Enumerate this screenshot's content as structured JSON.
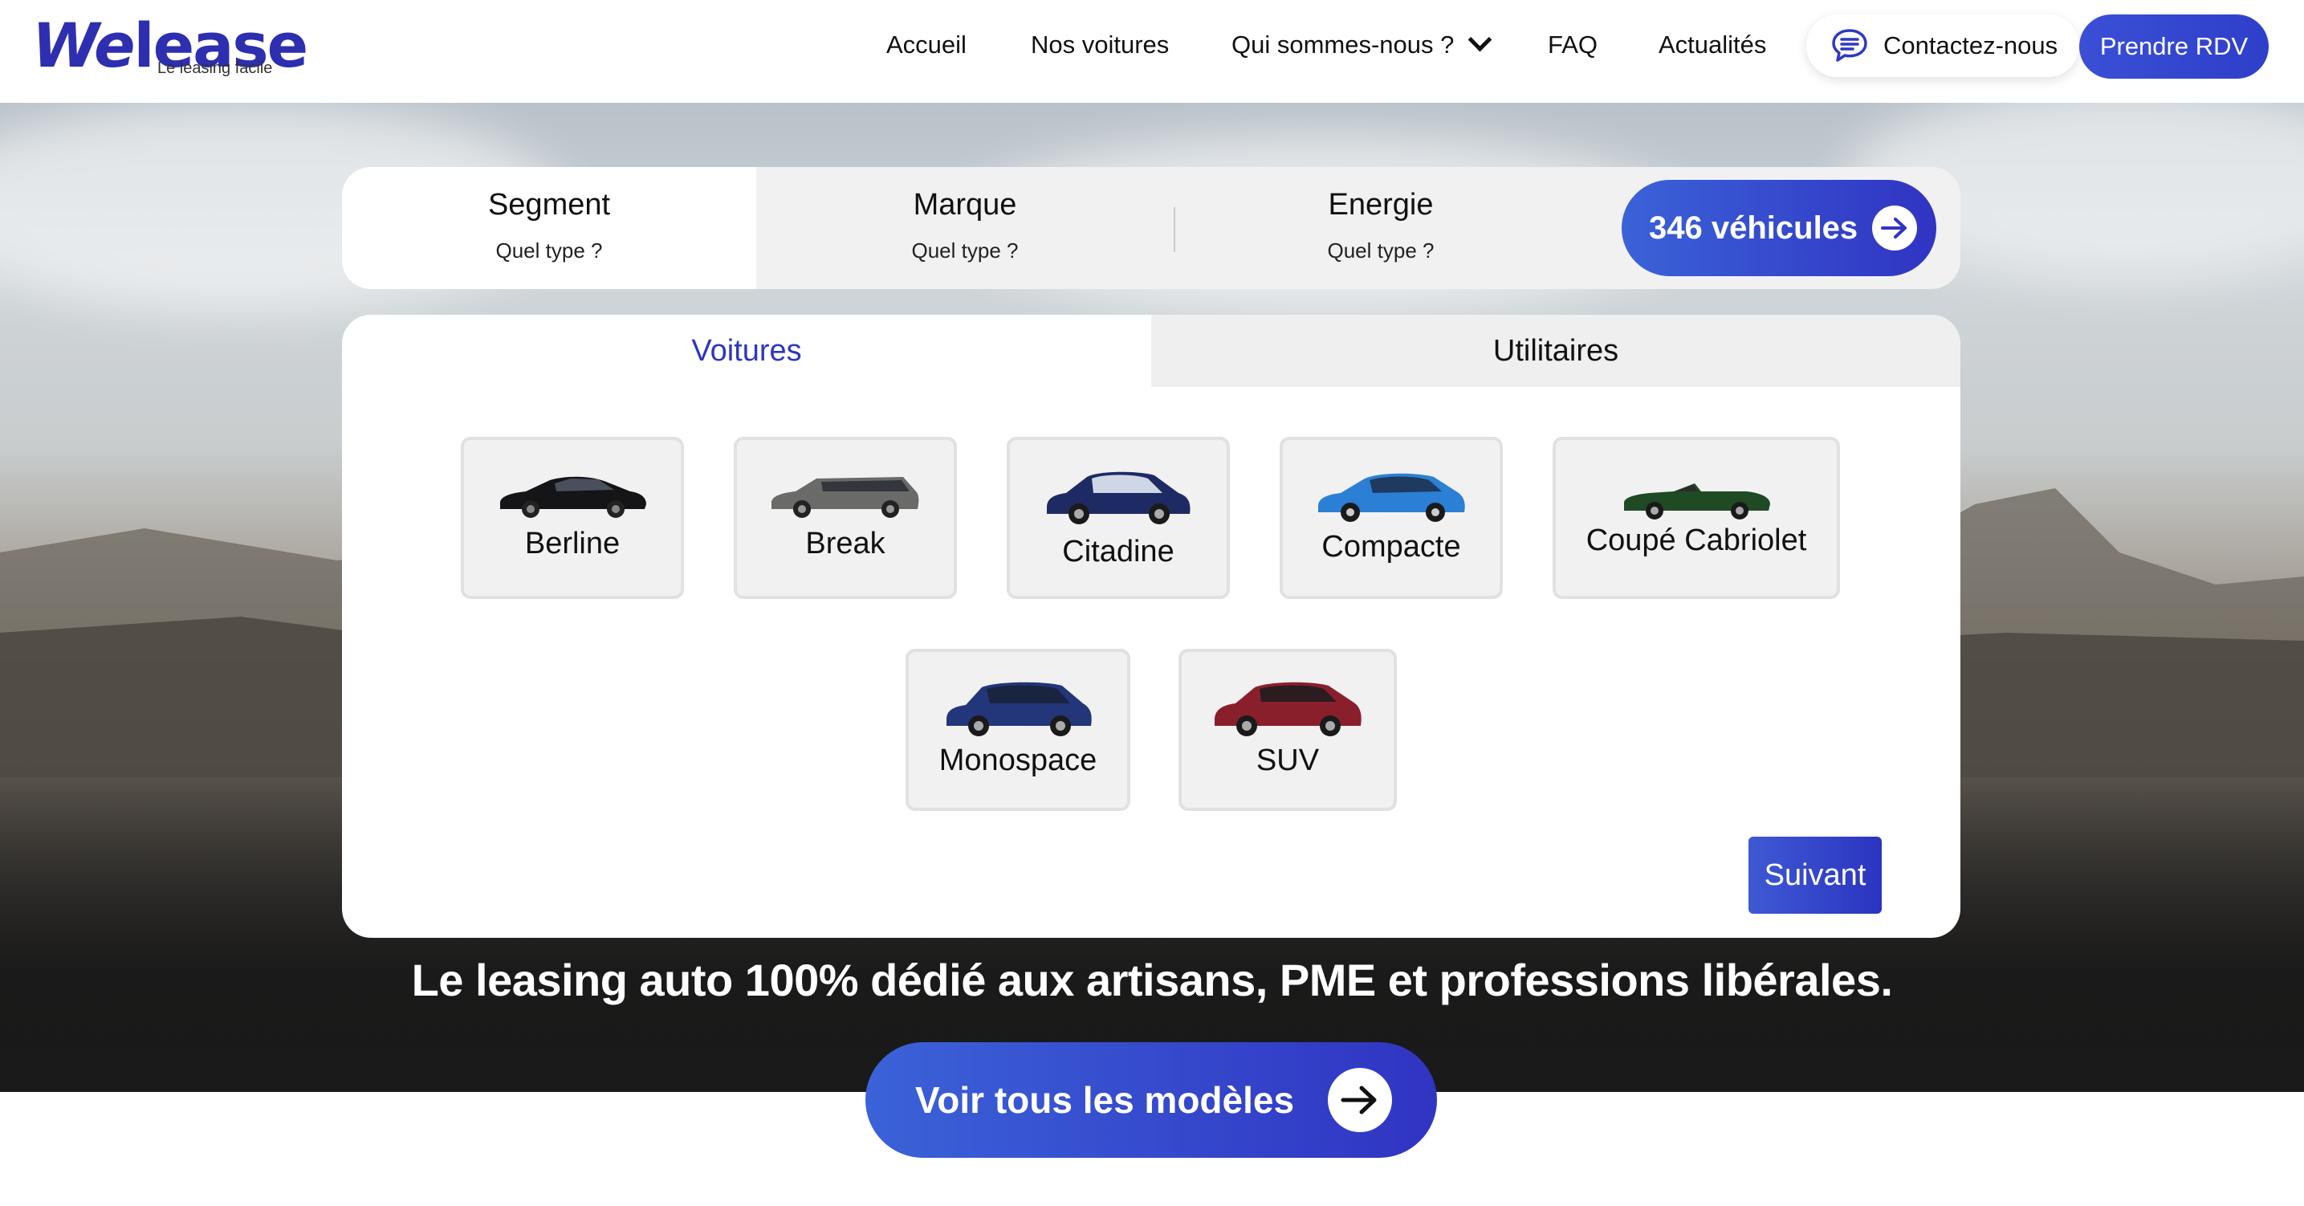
{
  "brand": {
    "logo_prefix": "We",
    "logo_suffix": "lease",
    "tagline": "Le leasing facile"
  },
  "nav": {
    "items": [
      "Accueil",
      "Nos voitures",
      "Qui sommes-nous ?",
      "FAQ",
      "Actualités"
    ],
    "contact_label": "Contactez-nous",
    "rdv_label": "Prendre RDV"
  },
  "filters": [
    {
      "title": "Segment",
      "subtitle": "Quel type ?",
      "active": true
    },
    {
      "title": "Marque",
      "subtitle": "Quel type ?",
      "active": false
    },
    {
      "title": "Energie",
      "subtitle": "Quel type ?",
      "active": false
    }
  ],
  "vehicle_count_label": "346 véhicules",
  "tabs": {
    "voitures": "Voitures",
    "utilitaires": "Utilitaires",
    "active": "voitures"
  },
  "segments": [
    {
      "label": "Berline",
      "color": "#151518"
    },
    {
      "label": "Break",
      "color": "#6a6a68"
    },
    {
      "label": "Citadine",
      "color": "#1d2a63"
    },
    {
      "label": "Compacte",
      "color": "#2b7fd4"
    },
    {
      "label": "Coupé Cabriolet",
      "color": "#1f4a24"
    },
    {
      "label": "Monospace",
      "color": "#23367a"
    },
    {
      "label": "SUV",
      "color": "#8a1f2c"
    }
  ],
  "next_button": "Suivant",
  "hero_tagline": "Le leasing auto 100% dédié aux artisans, PME et professions libérales.",
  "cta_label": "Voir tous les modèles",
  "accent_color": "#3034c2"
}
